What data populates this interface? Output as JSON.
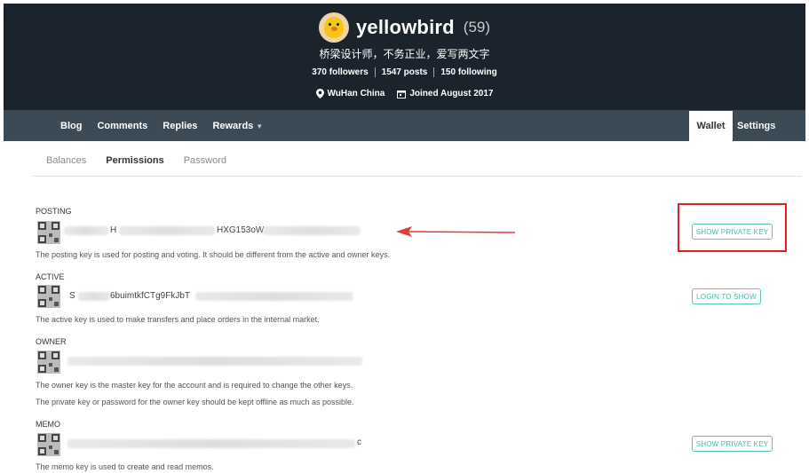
{
  "profile": {
    "username": "yellowbird",
    "reputation": "(59)",
    "bio": "桥梁设计师，不务正业，爱写两文字",
    "stats": {
      "followers": "370 followers",
      "posts": "1547 posts",
      "following": "150 following"
    },
    "location": "WuHan China",
    "joined": "Joined August 2017"
  },
  "nav": {
    "left": [
      "Blog",
      "Comments",
      "Replies",
      "Rewards"
    ],
    "wallet": "Wallet",
    "settings": "Settings"
  },
  "subtabs": {
    "balances": "Balances",
    "permissions": "Permissions",
    "password": "Password"
  },
  "keys": {
    "posting": {
      "title": "POSTING",
      "visible_fragment_1": "H",
      "visible_fragment_2": "HXG153oW",
      "description": "The posting key is used for posting and voting. It should be different from the active and owner keys.",
      "button": "SHOW PRIVATE KEY"
    },
    "active": {
      "title": "ACTIVE",
      "visible_fragment_1": "S",
      "visible_fragment_2": "6buimtkfCTg9FkJbT",
      "description": "The active key is used to make transfers and place orders in the internal market.",
      "button": "LOGIN TO SHOW"
    },
    "owner": {
      "title": "OWNER",
      "description_1": "The owner key is the master key for the account and is required to change the other keys.",
      "description_2": "The private key or password for the owner key should be kept offline as much as possible."
    },
    "memo": {
      "title": "MEMO",
      "visible_fragment": "c",
      "description": "The memo key is used to create and read memos.",
      "button": "SHOW PRIVATE KEY"
    }
  },
  "colors": {
    "header_bg": "#1b242c",
    "navbar_bg": "#3b4a55",
    "button_border": "#5cc3b6",
    "highlight": "#e02020"
  }
}
